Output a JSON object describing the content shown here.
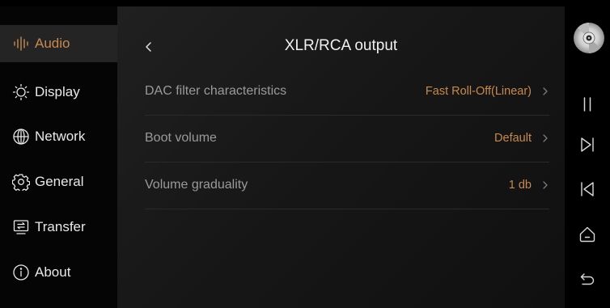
{
  "colors": {
    "accent": "#c7894f",
    "sidebar_active_bg": "#242424",
    "label_gray": "#9a9a9a",
    "text_white": "#f0f0f0"
  },
  "sidebar": {
    "items": [
      {
        "label": "Audio",
        "icon": "audio-waveform-icon",
        "active": true
      },
      {
        "label": "Display",
        "icon": "sun-icon",
        "active": false
      },
      {
        "label": "Network",
        "icon": "globe-icon",
        "active": false
      },
      {
        "label": "General",
        "icon": "gear-icon",
        "active": false
      },
      {
        "label": "Transfer",
        "icon": "transfer-icon",
        "active": false
      },
      {
        "label": "About",
        "icon": "info-icon",
        "active": false
      }
    ]
  },
  "header": {
    "back_icon": "chevron-left-icon",
    "title": "XLR/RCA output"
  },
  "settings": {
    "rows": [
      {
        "label": "DAC filter characteristics",
        "value": "Fast Roll-Off(Linear)"
      },
      {
        "label": "Boot volume",
        "value": "Default"
      },
      {
        "label": "Volume graduality",
        "value": "1 db"
      }
    ]
  },
  "controls": {
    "items": [
      "disc-icon",
      "pause-icon",
      "next-track-icon",
      "previous-track-icon",
      "home-icon",
      "return-icon"
    ]
  }
}
